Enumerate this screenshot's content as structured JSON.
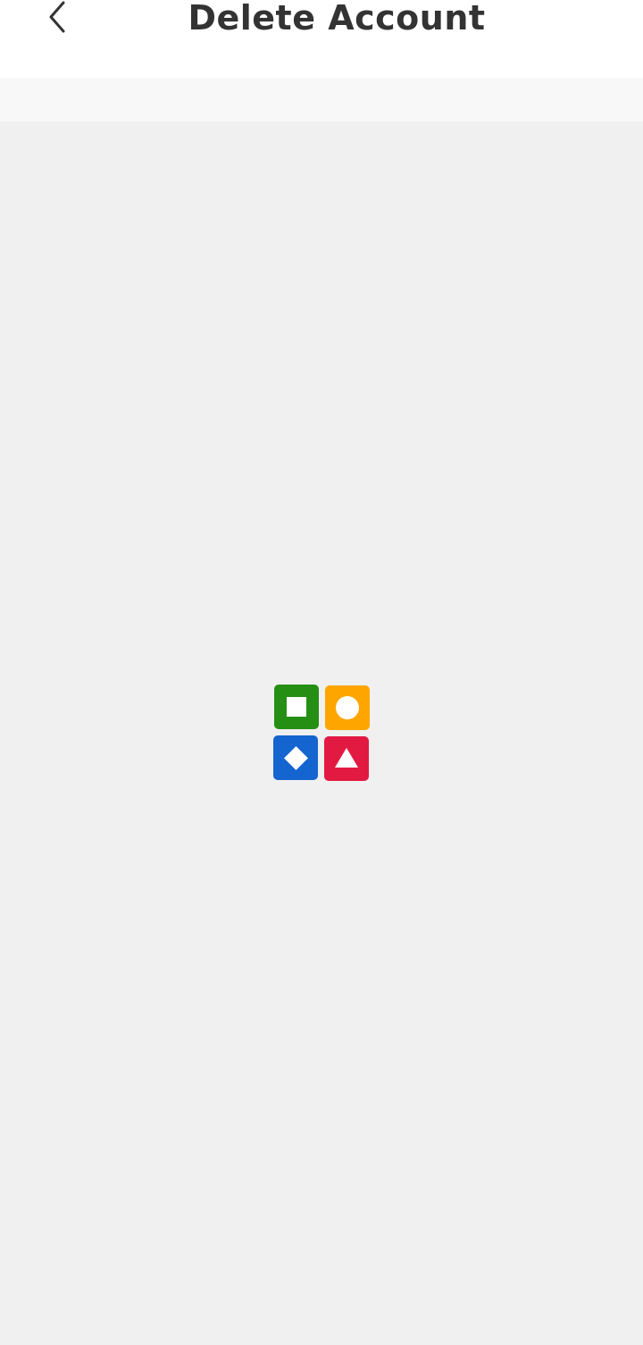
{
  "header": {
    "title": "Delete Account",
    "back_icon": "chevron-left-icon"
  },
  "loader": {
    "icon": "loading-shapes-icon",
    "tiles": [
      {
        "shape": "square",
        "color": "#258f14"
      },
      {
        "shape": "circle",
        "color": "#ffa500"
      },
      {
        "shape": "diamond",
        "color": "#1565d0"
      },
      {
        "shape": "triangle",
        "color": "#e21a42"
      }
    ]
  },
  "colors": {
    "header_bg": "#ffffff",
    "subbar_bg": "#f8f8f8",
    "content_bg": "#f0f0f0",
    "title_text": "#333333"
  }
}
